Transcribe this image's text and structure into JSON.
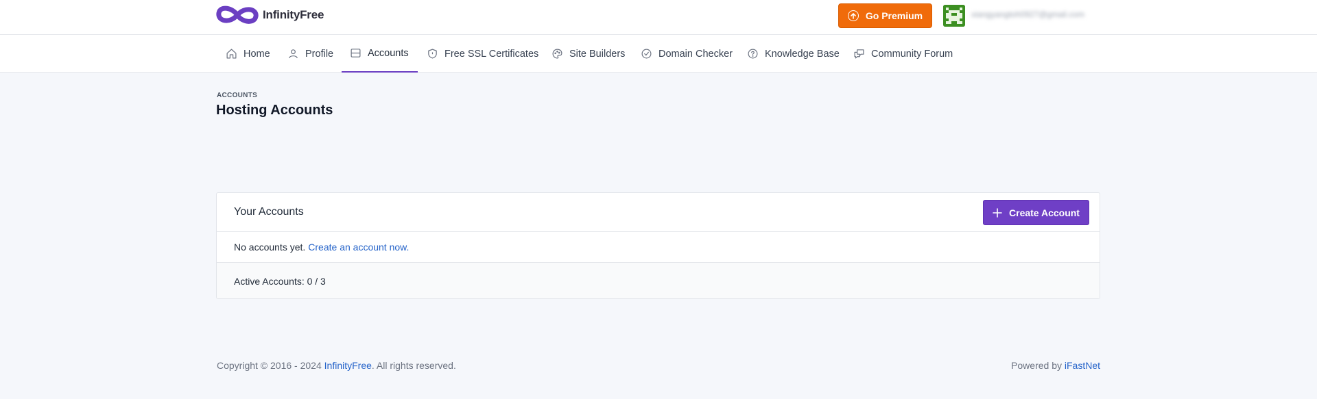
{
  "header": {
    "brand_name": "InfinityFree",
    "premium_label": "Go Premium",
    "user_email": "xiangyangtoh0927@gmail.com",
    "brand_color": "#6b3fc2",
    "premium_color": "#f06b0a"
  },
  "nav": {
    "items": [
      {
        "label": "Home",
        "icon": "home-icon"
      },
      {
        "label": "Profile",
        "icon": "user-icon"
      },
      {
        "label": "Accounts",
        "icon": "server-icon",
        "active": true
      },
      {
        "label": "Free SSL Certificates",
        "icon": "shield-icon"
      },
      {
        "label": "Site Builders",
        "icon": "palette-icon"
      },
      {
        "label": "Domain Checker",
        "icon": "check-circle-icon"
      },
      {
        "label": "Knowledge Base",
        "icon": "help-circle-icon"
      },
      {
        "label": "Community Forum",
        "icon": "chat-icon"
      }
    ]
  },
  "page": {
    "breadcrumb": "ACCOUNTS",
    "title": "Hosting Accounts"
  },
  "accounts_card": {
    "title": "Your Accounts",
    "create_label": "Create Account",
    "empty_text": "No accounts yet.",
    "create_link": "Create an account now.",
    "active_label": "Active Accounts: 0 / 3"
  },
  "footer": {
    "copyright_prefix": "Copyright © 2016 - 2024",
    "company_link": "InfinityFree",
    "copyright_suffix": ". All rights reserved.",
    "powered_prefix": "Powered by",
    "powered_link": "iFastNet"
  }
}
